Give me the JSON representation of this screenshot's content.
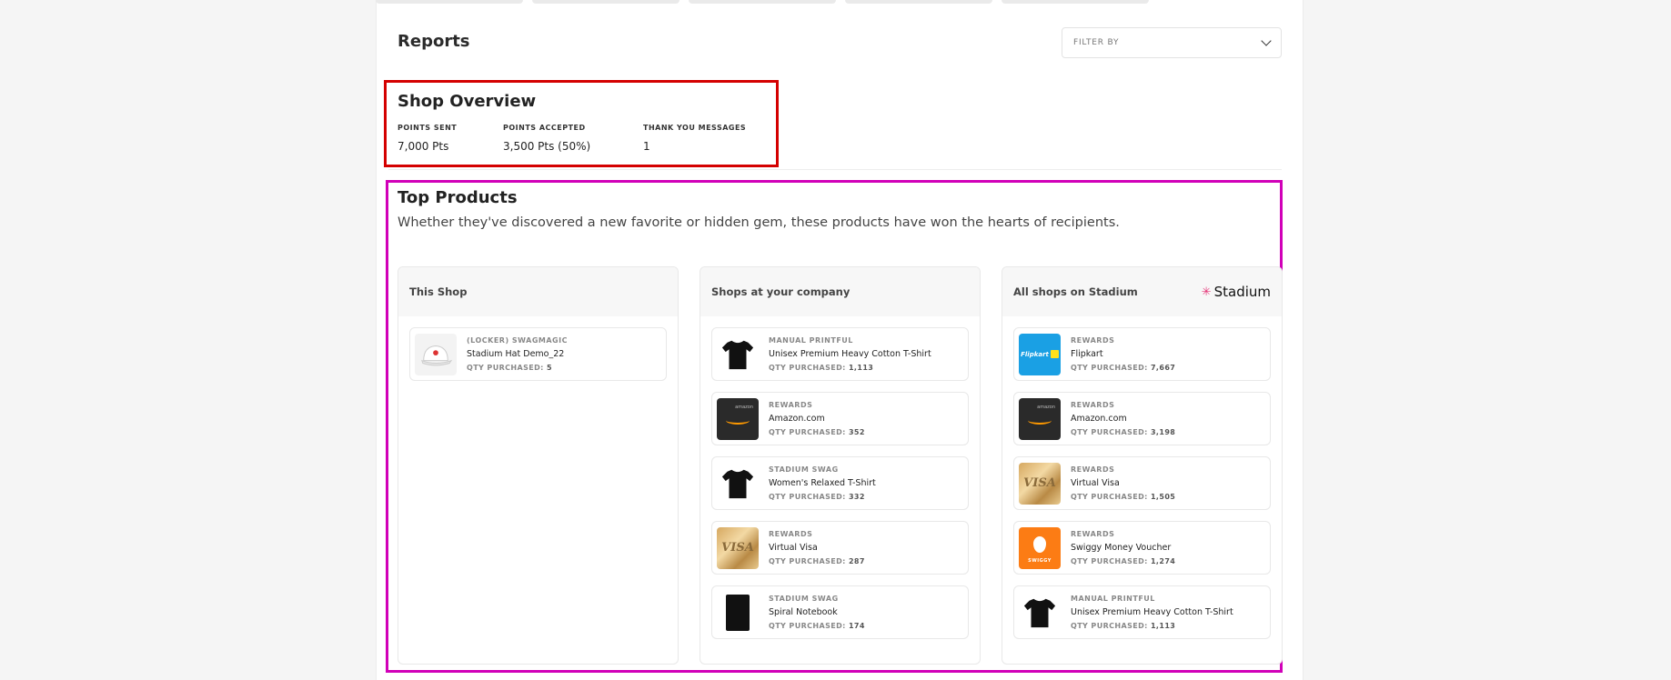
{
  "header": {
    "title": "Reports",
    "filter_label": "FILTER BY"
  },
  "overview": {
    "title": "Shop Overview",
    "stats": [
      {
        "label": "POINTS SENT",
        "value": "7,000 Pts"
      },
      {
        "label": "POINTS ACCEPTED",
        "value": "3,500 Pts (50%)"
      },
      {
        "label": "THANK YOU MESSAGES",
        "value": "1"
      }
    ]
  },
  "top_products": {
    "title": "Top Products",
    "subtitle": "Whether they've discovered a new favorite or hidden gem, these products have won the hearts of recipients.",
    "qty_label": "QTY PURCHASED:",
    "columns": [
      {
        "title": "This Shop",
        "items": [
          {
            "source": "(LOCKER) SWAGMAGIC",
            "name": "Stadium Hat Demo_22",
            "qty": "5",
            "icon": "hat-icon"
          }
        ]
      },
      {
        "title": "Shops at your company",
        "items": [
          {
            "source": "MANUAL PRINTFUL",
            "name": "Unisex Premium Heavy Cotton T-Shirt",
            "qty": "1,113",
            "icon": "tshirt-icon"
          },
          {
            "source": "REWARDS",
            "name": "Amazon.com",
            "qty": "352",
            "icon": "amazon-icon"
          },
          {
            "source": "STADIUM SWAG",
            "name": "Women's Relaxed T-Shirt",
            "qty": "332",
            "icon": "tshirt-icon"
          },
          {
            "source": "REWARDS",
            "name": "Virtual Visa",
            "qty": "287",
            "icon": "visa-icon"
          },
          {
            "source": "STADIUM SWAG",
            "name": "Spiral Notebook",
            "qty": "174",
            "icon": "notebook-icon"
          }
        ]
      },
      {
        "title": "All shops on Stadium",
        "brand": "Stadium",
        "items": [
          {
            "source": "REWARDS",
            "name": "Flipkart",
            "qty": "7,667",
            "icon": "flipkart-icon"
          },
          {
            "source": "REWARDS",
            "name": "Amazon.com",
            "qty": "3,198",
            "icon": "amazon-icon"
          },
          {
            "source": "REWARDS",
            "name": "Virtual Visa",
            "qty": "1,505",
            "icon": "visa-icon"
          },
          {
            "source": "REWARDS",
            "name": "Swiggy Money Voucher",
            "qty": "1,274",
            "icon": "swiggy-icon"
          },
          {
            "source": "MANUAL PRINTFUL",
            "name": "Unisex Premium Heavy Cotton T-Shirt",
            "qty": "1,113",
            "icon": "tshirt-icon"
          }
        ]
      }
    ]
  },
  "annotations": {
    "overview_box_color": "#d40000",
    "products_box_color": "#d100b8"
  },
  "thumb_text": {
    "visa": "VISA",
    "flipkart": "Flipkart",
    "swiggy": "SWIGGY",
    "amazon": "amazon"
  }
}
